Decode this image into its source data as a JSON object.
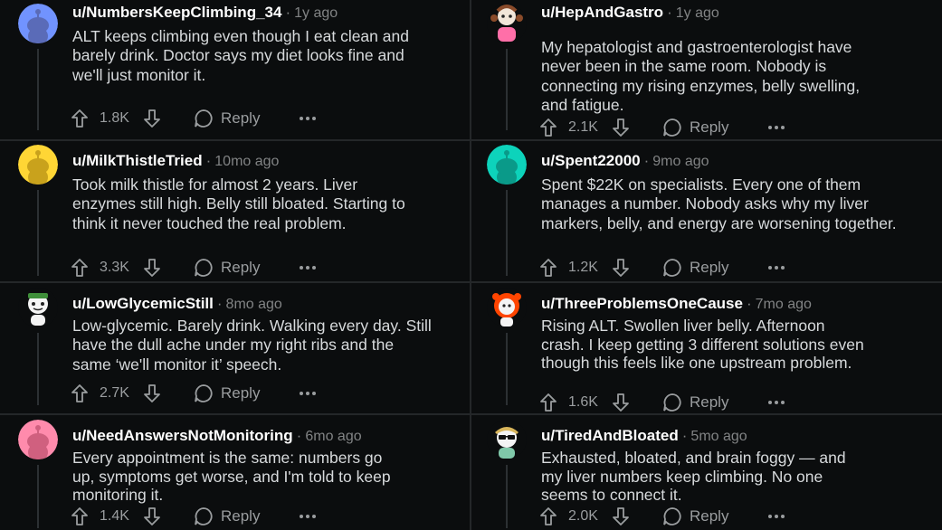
{
  "comments": [
    {
      "username": "u/NumbersKeepClimbing_34",
      "age": "1y ago",
      "body": "ALT keeps climbing even though I eat clean and barely drink. Doctor says my diet looks fine and we'll just monitor it.",
      "score": "1.8K",
      "reply_label": "Reply",
      "avatar_color": "#7193ff",
      "avatar_icon": "snoo-avatar-icon"
    },
    {
      "username": "u/HepAndGastro",
      "age": "1y ago",
      "body": "My hepatologist and gastroenterologist have never been in the same room. Nobody is connecting my rising enzymes, belly swelling, and fatigue.",
      "score": "2.1K",
      "reply_label": "Reply",
      "avatar_color": "#ffffff",
      "avatar_icon": "snoo-avatar-icon"
    },
    {
      "username": "u/MilkThistleTried",
      "age": "10mo ago",
      "body": "Took milk thistle for almost 2 years. Liver enzymes still high. Belly still bloated. Starting to think it never touched the real problem.",
      "score": "3.3K",
      "reply_label": "Reply",
      "avatar_color": "#ffd635",
      "avatar_icon": "snoo-avatar-icon"
    },
    {
      "username": "u/Spent22000",
      "age": "9mo ago",
      "body": "Spent $22K on specialists. Every one of them manages a number. Nobody asks why my liver markers, belly, and energy are worsening together.",
      "score": "1.2K",
      "reply_label": "Reply",
      "avatar_color": "#0dd3bb",
      "avatar_icon": "snoo-avatar-icon"
    },
    {
      "username": "u/LowGlycemicStill",
      "age": "8mo ago",
      "body": "Low-glycemic. Barely drink. Walking every day. Still have the dull ache under my right ribs and the same ‘we'll monitor it’ speech.",
      "score": "2.7K",
      "reply_label": "Reply",
      "avatar_color": "#ffffff",
      "avatar_icon": "snoo-avatar-icon"
    },
    {
      "username": "u/ThreeProblemsOneCause",
      "age": "7mo ago",
      "body": "Rising ALT. Swollen liver belly. Afternoon crash. I keep getting 3 different solutions even though this feels like one upstream problem.",
      "score": "1.6K",
      "reply_label": "Reply",
      "avatar_color": "#ff4500",
      "avatar_icon": "snoo-avatar-icon"
    },
    {
      "username": "u/NeedAnswersNotMonitoring",
      "age": "6mo ago",
      "body": "Every appointment is the same: numbers go up, symptoms get worse, and I'm told to keep monitoring it.",
      "score": "1.4K",
      "reply_label": "Reply",
      "avatar_color": "#ff8bac",
      "avatar_icon": "snoo-avatar-icon"
    },
    {
      "username": "u/TiredAndBloated",
      "age": "5mo ago",
      "body": "Exhausted, bloated, and brain foggy — and my liver numbers keep climbing. No one seems to connect it.",
      "score": "2.0K",
      "reply_label": "Reply",
      "avatar_color": "#ffffff",
      "avatar_icon": "snoo-avatar-icon"
    }
  ],
  "colors": {
    "background": "#0b0d0e",
    "divider": "#242729",
    "muted": "#818384",
    "text": "#d7dadc"
  }
}
